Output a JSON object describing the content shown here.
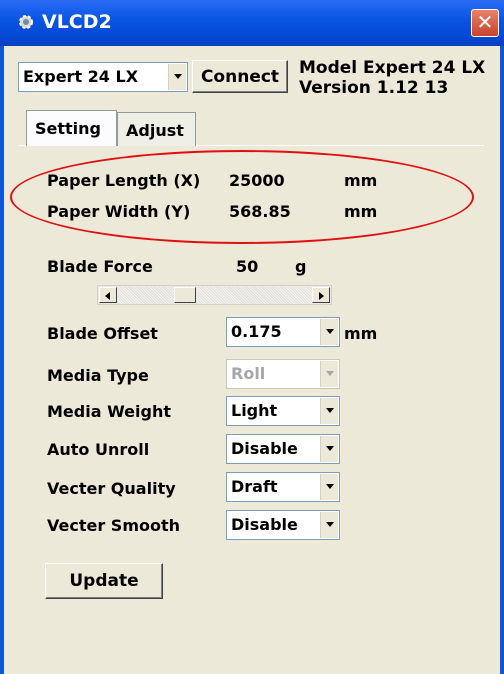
{
  "window": {
    "title": "VLCD2"
  },
  "toolbar": {
    "model_select": "Expert 24 LX",
    "connect_label": "Connect",
    "model_info_line1": "Model Expert 24 LX",
    "model_info_line2": "Version  1.12 13"
  },
  "tabs": [
    {
      "label": "Setting",
      "active": true
    },
    {
      "label": "Adjust",
      "active": false
    }
  ],
  "paper": {
    "length_label": "Paper Length (X)",
    "length_value": "25000",
    "length_unit": "mm",
    "width_label": "Paper Width (Y)",
    "width_value": "568.85",
    "width_unit": "mm"
  },
  "blade_force": {
    "label": "Blade Force",
    "value": "50",
    "unit": "g",
    "slider_fraction": 0.33
  },
  "blade_offset": {
    "label": "Blade Offset",
    "value": "0.175",
    "unit": "mm"
  },
  "media_type": {
    "label": "Media Type",
    "value": "Roll",
    "disabled": true
  },
  "media_weight": {
    "label": "Media Weight",
    "value": "Light"
  },
  "auto_unroll": {
    "label": "Auto Unroll",
    "value": "Disable"
  },
  "vecter_quality": {
    "label": "Vecter Quality",
    "value": "Draft"
  },
  "vecter_smooth": {
    "label": "Vecter Smooth",
    "value": "Disable"
  },
  "update_label": "Update",
  "colors": {
    "title_bar": "#0a56e4",
    "annotation_ellipse": "#e01010",
    "close_button": "#d4553c"
  }
}
